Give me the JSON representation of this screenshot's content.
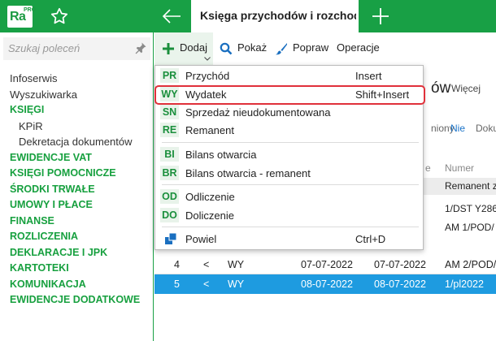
{
  "app": {
    "logo_text": "Ra",
    "logo_sup": "PRO",
    "active_tab_title": "Księga przychodów i rozchodów",
    "icons": {
      "favorite": "star-outline-icon",
      "back": "arrow-left-icon",
      "new_tab": "plus-icon"
    },
    "brand_color": "#18a045"
  },
  "sidebar": {
    "search_placeholder": "Szukaj poleceń",
    "items": [
      {
        "label": "Infoserwis",
        "kind": "link"
      },
      {
        "label": "Wyszukiwarka",
        "kind": "link"
      },
      {
        "label": "KSIĘGI",
        "kind": "section"
      },
      {
        "label": "KPiR",
        "kind": "sub"
      },
      {
        "label": "Dekretacja dokumentów",
        "kind": "sub"
      },
      {
        "label": "EWIDENCJE VAT",
        "kind": "section"
      },
      {
        "label": "KSIĘGI POMOCNICZE",
        "kind": "section"
      },
      {
        "label": "ŚRODKI TRWAŁE",
        "kind": "section"
      },
      {
        "label": "UMOWY I PŁACE",
        "kind": "section"
      },
      {
        "label": "FINANSE",
        "kind": "section"
      },
      {
        "label": "ROZLICZENIA",
        "kind": "section"
      },
      {
        "label": "DEKLARACJE I JPK",
        "kind": "section"
      },
      {
        "label": "KARTOTEKI",
        "kind": "section"
      },
      {
        "label": "KOMUNIKACJA",
        "kind": "section"
      },
      {
        "label": "EWIDENCJE DODATKOWE",
        "kind": "section"
      }
    ]
  },
  "toolbar": {
    "dodaj": "Dodaj",
    "pokaz": "Pokaż",
    "popraw": "Popraw",
    "operacje": "Operacje"
  },
  "background": {
    "heading_fragment": "ów",
    "more_link": "Więcej",
    "filter_fragment": "niony",
    "filter_value": "Nie",
    "filter_next": "Doku",
    "col_fragment": "e",
    "col_numer": "Numer",
    "band_text": "Remanent z",
    "hidden_row_1_num": "1/DST Y286",
    "hidden_row_2_num": "AM 1/POD/",
    "rows": [
      {
        "lp": "4",
        "arrow": "<",
        "type": "WY",
        "date1": "07-07-2022",
        "date2": "07-07-2022",
        "num": "AM 2/POD/",
        "selected": false
      },
      {
        "lp": "5",
        "arrow": "<",
        "type": "WY",
        "date1": "08-07-2022",
        "date2": "08-07-2022",
        "num": "1/pl2022",
        "selected": true
      }
    ]
  },
  "dropdown": {
    "items": [
      {
        "code": "PR",
        "label": "Przychód",
        "shortcut": "Insert"
      },
      {
        "code": "WY",
        "label": "Wydatek",
        "shortcut": "Shift+Insert",
        "highlighted": true
      },
      {
        "code": "SN",
        "label": "Sprzedaż nieudokumentowana",
        "shortcut": ""
      },
      {
        "code": "RE",
        "label": "Remanent",
        "shortcut": ""
      },
      {
        "code": "BI",
        "label": "Bilans otwarcia",
        "shortcut": ""
      },
      {
        "code": "BR",
        "label": "Bilans otwarcia - remanent",
        "shortcut": ""
      },
      {
        "code": "OD",
        "label": "Odliczenie",
        "shortcut": ""
      },
      {
        "code": "DO",
        "label": "Doliczenie",
        "shortcut": ""
      },
      {
        "code": "",
        "label": "Powiel",
        "shortcut": "Ctrl+D",
        "icon": "copy-icon"
      }
    ]
  }
}
